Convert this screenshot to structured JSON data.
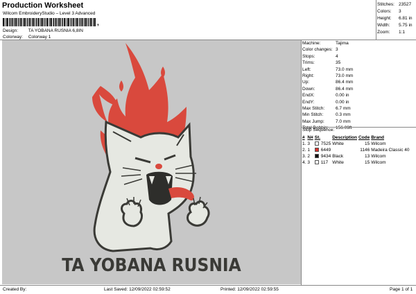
{
  "header": {
    "title": "Production Worksheet",
    "subtitle": "Wilcom EmbroideryStudio – Level 3 Advanced",
    "barcode_suffix": ","
  },
  "meta": {
    "design_label": "Design:",
    "design_value": "TA YOBANA RUSNIA 6,8IN",
    "colorway_label": "Colorway:",
    "colorway_value": "Colorway 1"
  },
  "stats": [
    {
      "label": "Stitches:",
      "value": "23527"
    },
    {
      "label": "Colors:",
      "value": "3"
    },
    {
      "label": "Height:",
      "value": "6.81 in"
    },
    {
      "label": "Width:",
      "value": "5.75 in"
    },
    {
      "label": "Zoom:",
      "value": "1:1"
    }
  ],
  "design": {
    "text": "TA YOBANA RUSNIA",
    "colors": {
      "background": "#c7c7c7",
      "flame": "#d9493d",
      "body": "#e6e8e2",
      "outline": "#3a3a36",
      "tongue": "#d9493d"
    }
  },
  "machine_info": [
    {
      "label": "Machine:",
      "value": "Tajima"
    },
    {
      "label": "Color changes:",
      "value": "3"
    },
    {
      "label": "Stops:",
      "value": "4"
    },
    {
      "label": "Trims:",
      "value": "35"
    },
    {
      "label": "Left:",
      "value": "73.0 mm"
    },
    {
      "label": "Right:",
      "value": "73.0 mm"
    },
    {
      "label": "Up:",
      "value": "86.4 mm"
    },
    {
      "label": "Down:",
      "value": "86.4 mm"
    },
    {
      "label": "EndX:",
      "value": "0.00 in"
    },
    {
      "label": "EndY:",
      "value": "0.00 in"
    },
    {
      "label": "Max Stitch:",
      "value": "6.7 mm"
    },
    {
      "label": "Min Stitch:",
      "value": "0.3 mm"
    },
    {
      "label": "Max Jump:",
      "value": "7.0 mm"
    },
    {
      "label": "Total Bobbin:",
      "value": "156.09ft"
    }
  ],
  "stop_sequence": {
    "title": "Stop Sequence:",
    "headers": [
      "#",
      "N#",
      "St.",
      "Description",
      "Code",
      "Brand"
    ],
    "rows": [
      {
        "idx": "1.",
        "n": "3",
        "color": "#ffffff",
        "st": "7525",
        "desc": "White",
        "code": "15",
        "brand": "Wilcom"
      },
      {
        "idx": "2.",
        "n": "1",
        "color": "#d9302b",
        "st": "6449",
        "desc": "",
        "code": "1146",
        "brand": "Madeira Classic 40"
      },
      {
        "idx": "3.",
        "n": "2",
        "color": "#111111",
        "st": "9434",
        "desc": "Black",
        "code": "13",
        "brand": "Wilcom"
      },
      {
        "idx": "4.",
        "n": "3",
        "color": "#ffffff",
        "st": "117",
        "desc": "White",
        "code": "15",
        "brand": "Wilcom"
      }
    ]
  },
  "footer": {
    "created_by": "Created By:",
    "last_saved": "Last Saved: 12/09/2022 02:59:52",
    "printed": "Printed: 12/09/2022 02:59:55",
    "page": "Page 1 of 1"
  }
}
